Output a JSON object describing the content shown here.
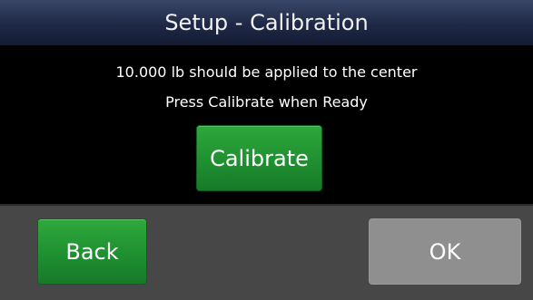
{
  "title_bar": {
    "title": "Setup - Calibration"
  },
  "message": {
    "line1": "10.000 lb should be applied to the center",
    "line2": "Press Calibrate when Ready"
  },
  "actions": {
    "calibrate_label": "Calibrate",
    "back_label": "Back",
    "ok_label": "OK"
  },
  "colors": {
    "title_bar": "#1e2846",
    "background": "#000000",
    "bottom_bar": "#474747",
    "primary_button": "#1f9030",
    "disabled_button": "#8f8f8f"
  }
}
